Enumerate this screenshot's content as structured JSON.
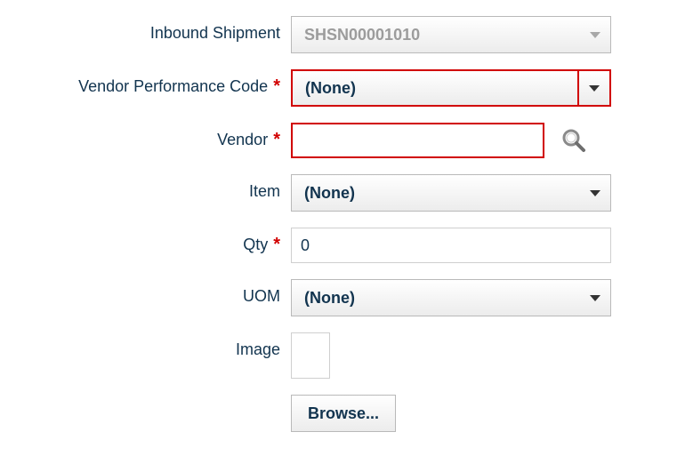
{
  "fields": {
    "inbound_shipment": {
      "label": "Inbound Shipment",
      "value": "SHSN00001010",
      "required": false
    },
    "vendor_perf_code": {
      "label": "Vendor Performance Code",
      "value": "(None)",
      "required": true
    },
    "vendor": {
      "label": "Vendor",
      "value": "",
      "required": true
    },
    "item": {
      "label": "Item",
      "value": "(None)",
      "required": false
    },
    "qty": {
      "label": "Qty",
      "value": "0",
      "required": true
    },
    "uom": {
      "label": "UOM",
      "value": "(None)",
      "required": false
    },
    "image": {
      "label": "Image",
      "browse_label": "Browse..."
    }
  }
}
